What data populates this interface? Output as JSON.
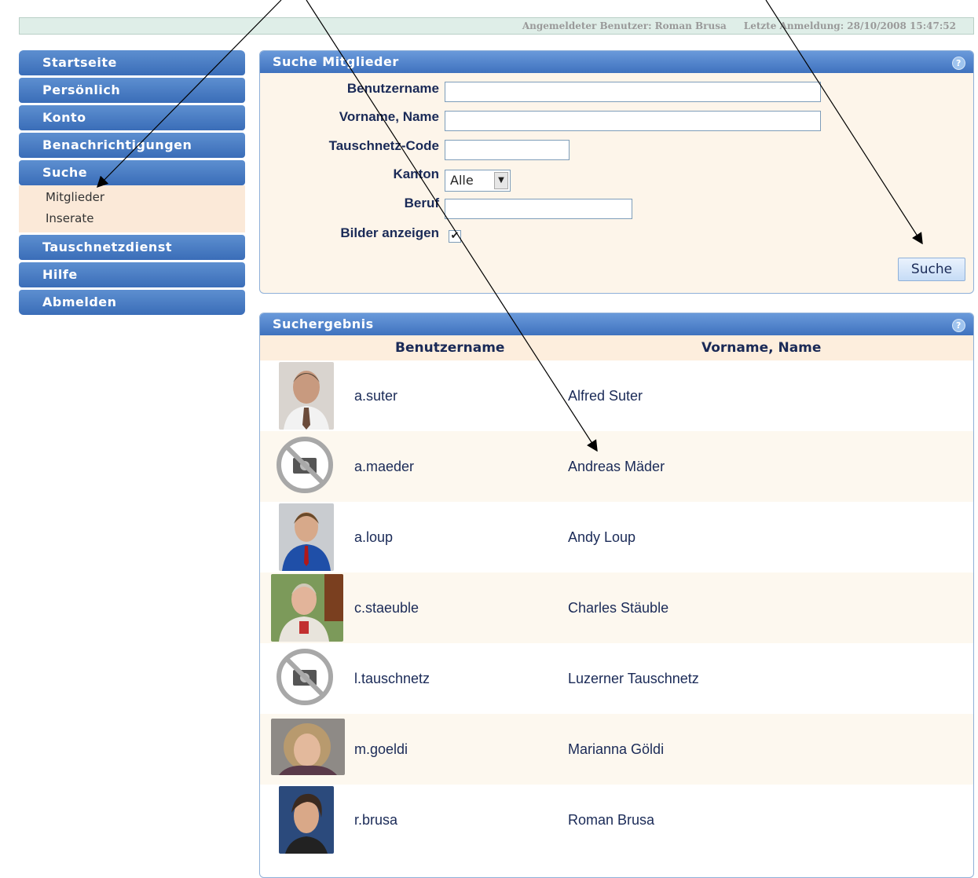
{
  "header": {
    "user_label": "Angemeldeter Benutzer: Roman Brusa",
    "last_login": "Letzte Anmeldung: 28/10/2008 15:47:52"
  },
  "nav": {
    "items": [
      "Startseite",
      "Persönlich",
      "Konto",
      "Benachrichtigungen",
      "Suche",
      "Tauschnetzdienst",
      "Hilfe",
      "Abmelden"
    ],
    "suche_sub": [
      "Mitglieder",
      "Inserate"
    ]
  },
  "search": {
    "title": "Suche Mitglieder",
    "help": "?",
    "labels": {
      "username": "Benutzername",
      "name": "Vorname, Name",
      "code": "Tauschnetz-Code",
      "canton": "Kanton",
      "job": "Beruf",
      "images": "Bilder anzeigen"
    },
    "values": {
      "username": "",
      "name": "",
      "code": "",
      "canton": "Alle",
      "job": "",
      "images_checked": true
    },
    "button": "Suche"
  },
  "results": {
    "title": "Suchergebnis",
    "help": "?",
    "columns": [
      "Benutzername",
      "Vorname, Name"
    ],
    "rows": [
      {
        "user": "a.suter",
        "name": "Alfred Suter",
        "photo": "photo"
      },
      {
        "user": "a.maeder",
        "name": "Andreas Mäder",
        "photo": "no-photo"
      },
      {
        "user": "a.loup",
        "name": "Andy Loup",
        "photo": "photo"
      },
      {
        "user": "c.staeuble",
        "name": "Charles Stäuble",
        "photo": "photo"
      },
      {
        "user": "l.tauschnetz",
        "name": "Luzerner Tauschnetz",
        "photo": "no-photo"
      },
      {
        "user": "m.goeldi",
        "name": "Marianna Göldi",
        "photo": "photo"
      },
      {
        "user": "r.brusa",
        "name": "Roman Brusa",
        "photo": "photo"
      }
    ]
  },
  "colors": {
    "nav_blue": "#4a7ec7",
    "panel_bg": "#fdf5ea",
    "text_dark": "#1a2a57"
  }
}
